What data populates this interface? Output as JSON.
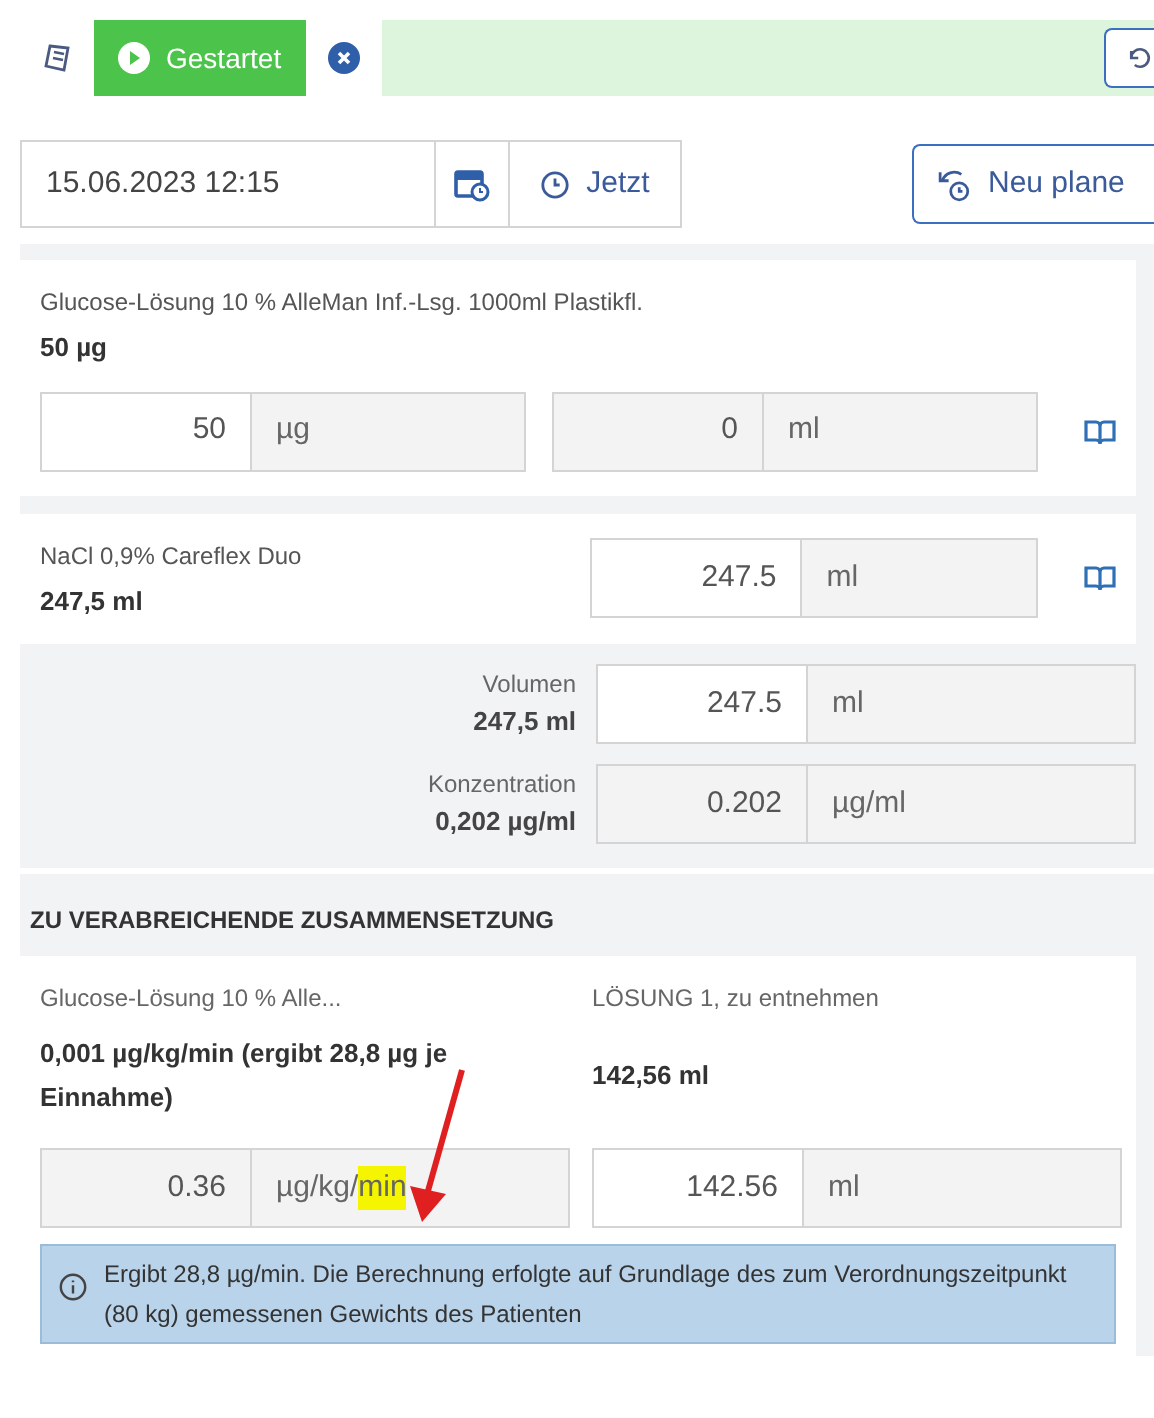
{
  "status_bar": {
    "status": {
      "label": "Gestartet",
      "selected": true
    }
  },
  "time_row": {
    "datetime": "15.06.2023 12:15",
    "now_button": "Jetzt",
    "replan_button": "Neu plane"
  },
  "components": [
    {
      "name": "Glucose-Lösung 10 % AlleMan Inf.-Lsg. 1000ml Plastikfl.",
      "amount": "50 µg",
      "fields": [
        {
          "value": "50",
          "unit": "µg",
          "editable": true
        },
        {
          "value": "0",
          "unit": "ml",
          "editable": false
        }
      ]
    },
    {
      "name": "NaCl 0,9% Careflex Duo",
      "amount": "247,5 ml",
      "fields": [
        {
          "value": "247.5",
          "unit": "ml",
          "editable": true
        }
      ]
    }
  ],
  "totals": [
    {
      "label": "Volumen",
      "amount": "247,5 ml",
      "field": {
        "value": "247.5",
        "unit": "ml",
        "editable": true
      }
    },
    {
      "label": "Konzentration",
      "amount": "0,202 µg/ml",
      "field": {
        "value": "0.202",
        "unit": "µg/ml",
        "editable": false
      }
    }
  ],
  "composition": {
    "heading": "ZU VERABREICHENDE ZUSAMMENSETZUNG",
    "left": {
      "name": "Glucose-Lösung 10 % Alle...",
      "amount": "0,001 µg/kg/min (ergibt 28,8 µg je Einnahme)",
      "field": {
        "value": "0.36",
        "unit": "µg/kg/",
        "unit_highlighted": "min",
        "editable": false
      }
    },
    "right": {
      "name": "LÖSUNG 1, zu entnehmen",
      "amount": "142,56 ml",
      "field": {
        "value": "142.56",
        "unit": "ml",
        "editable": true
      }
    },
    "info": "Ergibt 28,8 µg/min. Die Berechnung erfolgte auf Grundlage des zum Verordnungszeitpunkt (80 kg) gemessenen Gewichts des Patienten"
  }
}
